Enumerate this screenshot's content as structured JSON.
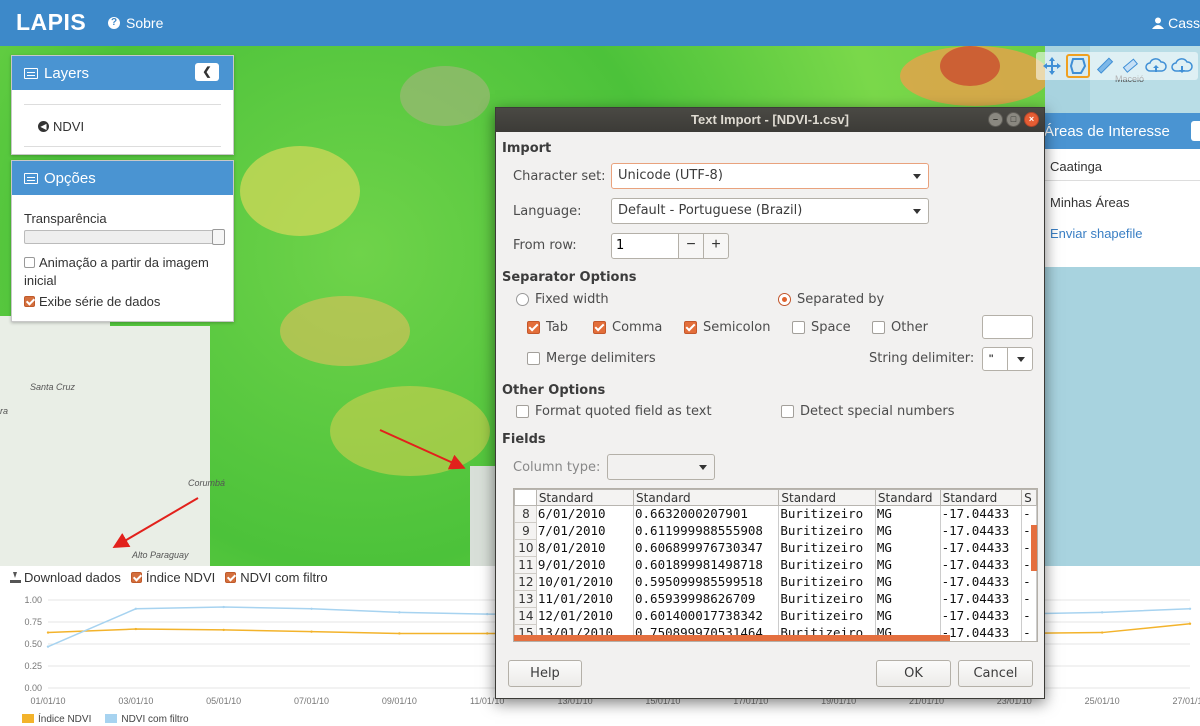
{
  "navbar": {
    "brand": "LAPIS",
    "about": "Sobre",
    "user": "Cass"
  },
  "layers": {
    "title": "Layers",
    "item": "NDVI"
  },
  "options": {
    "title": "Opções",
    "transparency_label": "Transparência",
    "transparency_value": 1.0,
    "animation_label": "Animação a partir da imagem inicial",
    "animation_checked": false,
    "series_label": "Exibe série de dados",
    "series_checked": true
  },
  "map_labels": {
    "santa_cruz": "Santa Cruz",
    "corumba": "Corumbá",
    "alto_paraguay": "Alto Paraguay",
    "maceio": "Maceió",
    "ra": "ra"
  },
  "areas": {
    "title": "Áreas de Interesse",
    "selected": "Caatinga",
    "my_areas": "Minhas Áreas",
    "send_shapefile": "Enviar shapefile"
  },
  "chart_toolbar": {
    "download": "Download dados",
    "ndvi_index": "Índice NDVI",
    "ndvi_filtered": "NDVI com filtro"
  },
  "chart_data": {
    "type": "line",
    "categories": [
      "01/01/10",
      "03/01/10",
      "05/01/10",
      "07/01/10",
      "09/01/10",
      "11/01/10",
      "13/01/10",
      "15/01/10",
      "17/01/10",
      "19/01/10",
      "21/01/10",
      "23/01/10",
      "25/01/10",
      "27/01/10"
    ],
    "ylim": [
      0,
      1
    ],
    "yticks": [
      "1.00",
      "0.75",
      "0.50",
      "0.25",
      "0.00"
    ],
    "series": [
      {
        "name": "Índice NDVI",
        "color": "#f3b32b",
        "values": [
          0.63,
          0.67,
          0.66,
          0.64,
          0.62,
          0.62,
          0.62,
          0.62,
          0.62,
          0.62,
          0.62,
          0.62,
          0.63,
          0.73
        ]
      },
      {
        "name": "NDVI com filtro",
        "color": "#a7d3f0",
        "values": [
          0.47,
          0.9,
          0.92,
          0.9,
          0.86,
          0.84,
          0.84,
          0.84,
          0.84,
          0.84,
          0.84,
          0.84,
          0.86,
          0.9
        ]
      }
    ]
  },
  "dialog": {
    "title": "Text Import - [NDVI-1.csv]",
    "import_heading": "Import",
    "charset_label": "Character set:",
    "charset_value": "Unicode (UTF-8)",
    "language_label": "Language:",
    "language_value": "Default - Portuguese (Brazil)",
    "from_row_label": "From row:",
    "from_row_value": "1",
    "separator_heading": "Separator Options",
    "fixed_width": "Fixed width",
    "separated_by": "Separated by",
    "tab": "Tab",
    "comma": "Comma",
    "semicolon": "Semicolon",
    "space": "Space",
    "other": "Other",
    "merge": "Merge delimiters",
    "string_delim_label": "String delimiter:",
    "string_delim_value": "\"",
    "other_heading": "Other Options",
    "format_quoted": "Format quoted field as text",
    "detect_special": "Detect special numbers",
    "fields_heading": "Fields",
    "column_type_label": "Column type:",
    "headers": [
      "Standard",
      "Standard",
      "Standard",
      "Standard",
      "Standard",
      "S"
    ],
    "rows": [
      {
        "n": "8",
        "c": [
          "6/01/2010",
          "0.6632000207901",
          "Buritizeiro",
          "MG",
          "-17.04433",
          "-"
        ]
      },
      {
        "n": "9",
        "c": [
          "7/01/2010",
          "0.611999988555908",
          "Buritizeiro",
          "MG",
          "-17.04433",
          "-"
        ]
      },
      {
        "n": "10",
        "c": [
          "8/01/2010",
          "0.606899976730347",
          "Buritizeiro",
          "MG",
          "-17.04433",
          "-"
        ]
      },
      {
        "n": "11",
        "c": [
          "9/01/2010",
          "0.601899981498718",
          "Buritizeiro",
          "MG",
          "-17.04433",
          "-"
        ]
      },
      {
        "n": "12",
        "c": [
          "10/01/2010",
          "0.595099985599518",
          "Buritizeiro",
          "MG",
          "-17.04433",
          "-"
        ]
      },
      {
        "n": "13",
        "c": [
          "11/01/2010",
          "0.65939998626709",
          "Buritizeiro",
          "MG",
          "-17.04433",
          "-"
        ]
      },
      {
        "n": "14",
        "c": [
          "12/01/2010",
          "0.601400017738342",
          "Buritizeiro",
          "MG",
          "-17.04433",
          "-"
        ]
      },
      {
        "n": "15",
        "c": [
          "13/01/2010",
          "0.750899970531464",
          "Buritizeiro",
          "MG",
          "-17.04433",
          "-"
        ]
      }
    ],
    "help": "Help",
    "ok": "OK",
    "cancel": "Cancel"
  }
}
